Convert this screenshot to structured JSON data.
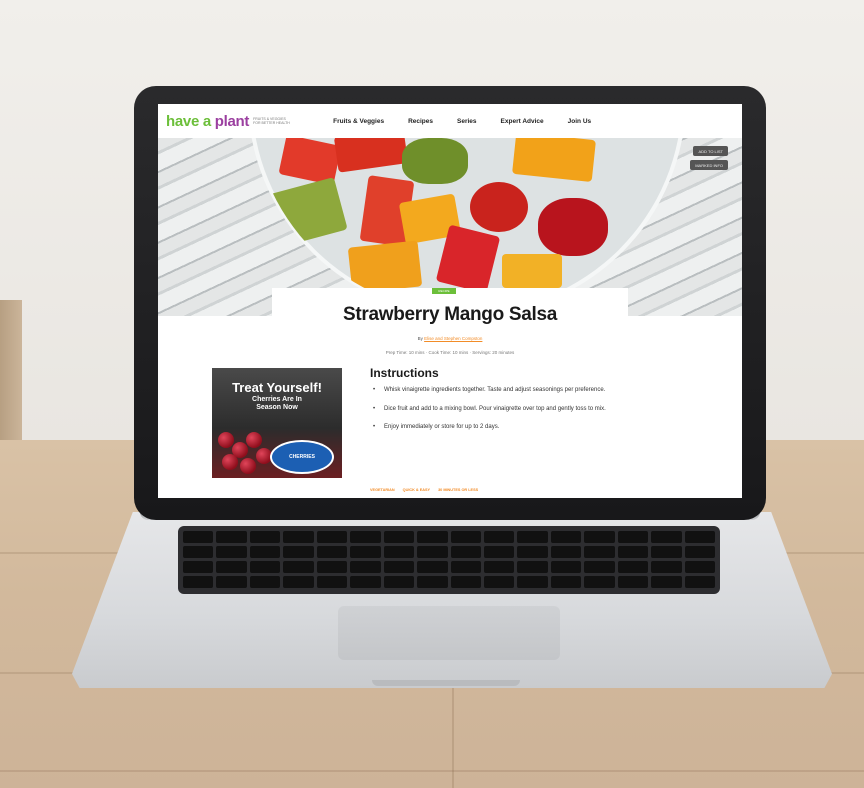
{
  "site": {
    "logo_main": "have a",
    "logo_accent": "plant",
    "logo_tagline": "FRUITS & VEGGIES FOR BETTER HEALTH",
    "nav": [
      {
        "label": "Fruits & Veggies"
      },
      {
        "label": "Recipes"
      },
      {
        "label": "Series"
      },
      {
        "label": "Expert Advice"
      },
      {
        "label": "Join Us"
      }
    ]
  },
  "hero": {
    "buttons": [
      {
        "label": "ADD TO LIST"
      },
      {
        "label": "MARKED INFO"
      }
    ],
    "badge": "RECIPE"
  },
  "recipe": {
    "title": "Strawberry Mango Salsa",
    "by_label": "By",
    "authors": "Elise and Stephen Compston",
    "meta": "Prep Time: 10 mins  ·  Cook Time: 10 mins  ·  Servings: 20 minutes",
    "instructions_heading": "Instructions",
    "steps": [
      {
        "text": "Whisk vinaigrette ingredients together. Taste and adjust seasonings per preference."
      },
      {
        "text": "Dice fruit and add to a mixing bowl. Pour vinaigrette over top and gently toss to mix."
      },
      {
        "text": "Enjoy immediately or store for up to 2 days."
      }
    ],
    "footer_links": [
      {
        "label": "VEGETARIAN"
      },
      {
        "label": "QUICK & EASY"
      },
      {
        "label": "30 MINUTES OR LESS"
      }
    ]
  },
  "ad": {
    "title": "Treat Yourself!",
    "subtitle_line1": "Cherries Are In",
    "subtitle_line2": "Season Now",
    "brand": "CHERRIES"
  },
  "colors": {
    "logo_green": "#6cbf3a",
    "logo_purple": "#9b3fa0",
    "link_orange": "#f28c28"
  }
}
